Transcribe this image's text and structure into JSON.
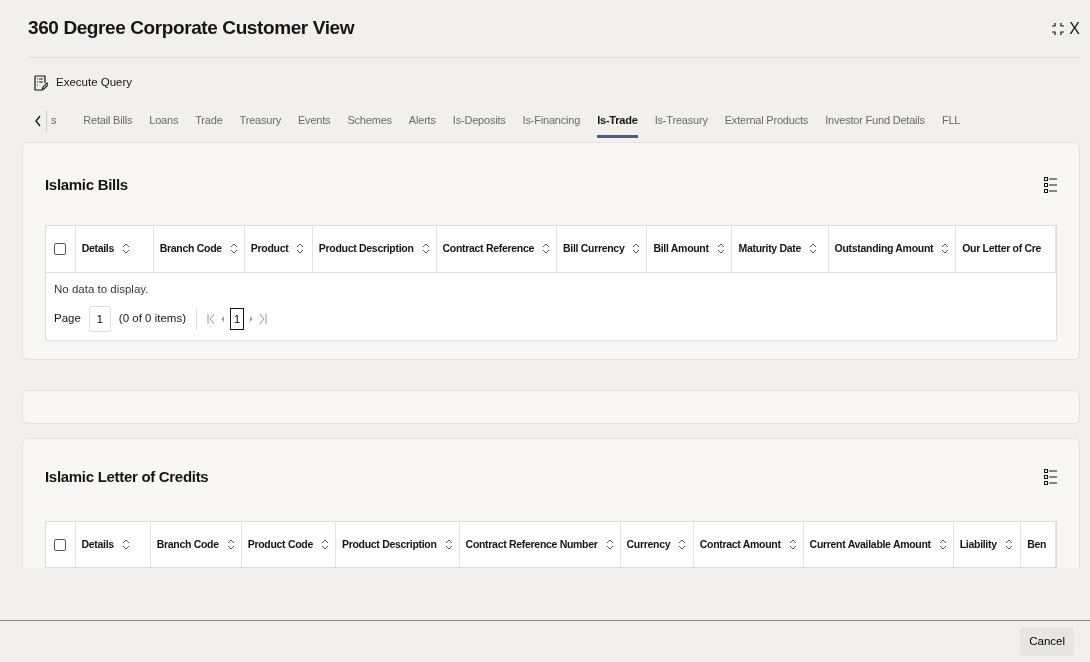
{
  "window": {
    "title": "360 Degree Corporate Customer View",
    "close_label": "X"
  },
  "toolbar": {
    "execute_query": "Execute Query"
  },
  "tabs": [
    {
      "label": "s",
      "selected": false
    },
    {
      "label": "Retail Bills",
      "selected": false
    },
    {
      "label": "Loans",
      "selected": false
    },
    {
      "label": "Trade",
      "selected": false
    },
    {
      "label": "Treasury",
      "selected": false
    },
    {
      "label": "Events",
      "selected": false
    },
    {
      "label": "Schemes",
      "selected": false
    },
    {
      "label": "Alerts",
      "selected": false
    },
    {
      "label": "Is-Deposits",
      "selected": false
    },
    {
      "label": "Is-Financing",
      "selected": false
    },
    {
      "label": "Is-Trade",
      "selected": true
    },
    {
      "label": "Is-Treasury",
      "selected": false
    },
    {
      "label": "External Products",
      "selected": false
    },
    {
      "label": "Investor Fund Details",
      "selected": false
    },
    {
      "label": "FLL",
      "selected": false
    }
  ],
  "sections": [
    {
      "kind": "table",
      "title": "Islamic Bills",
      "select_all_checked": false,
      "columns": [
        "Details",
        "Branch Code",
        "Product",
        "Product Description",
        "Contract Reference",
        "Bill Currency",
        "Bill Amount",
        "Maturity Date",
        "Outstanding Amount",
        "Our Letter of Cre"
      ],
      "empty_message": "No data to display.",
      "pagination": {
        "page_label": "Page",
        "page_value": "1",
        "items": "(0 of 0 items)",
        "current_page": "1"
      }
    },
    {
      "kind": "empty"
    },
    {
      "kind": "table",
      "title": "Islamic Letter of Credits",
      "select_all_checked": false,
      "columns": [
        "Details",
        "Branch Code",
        "Product Code",
        "Product Description",
        "Contract Reference Number",
        "Currency",
        "Contract Amount",
        "Current Available Amount",
        "Liability",
        "Ben"
      ]
    }
  ],
  "footer": {
    "cancel": "Cancel"
  }
}
